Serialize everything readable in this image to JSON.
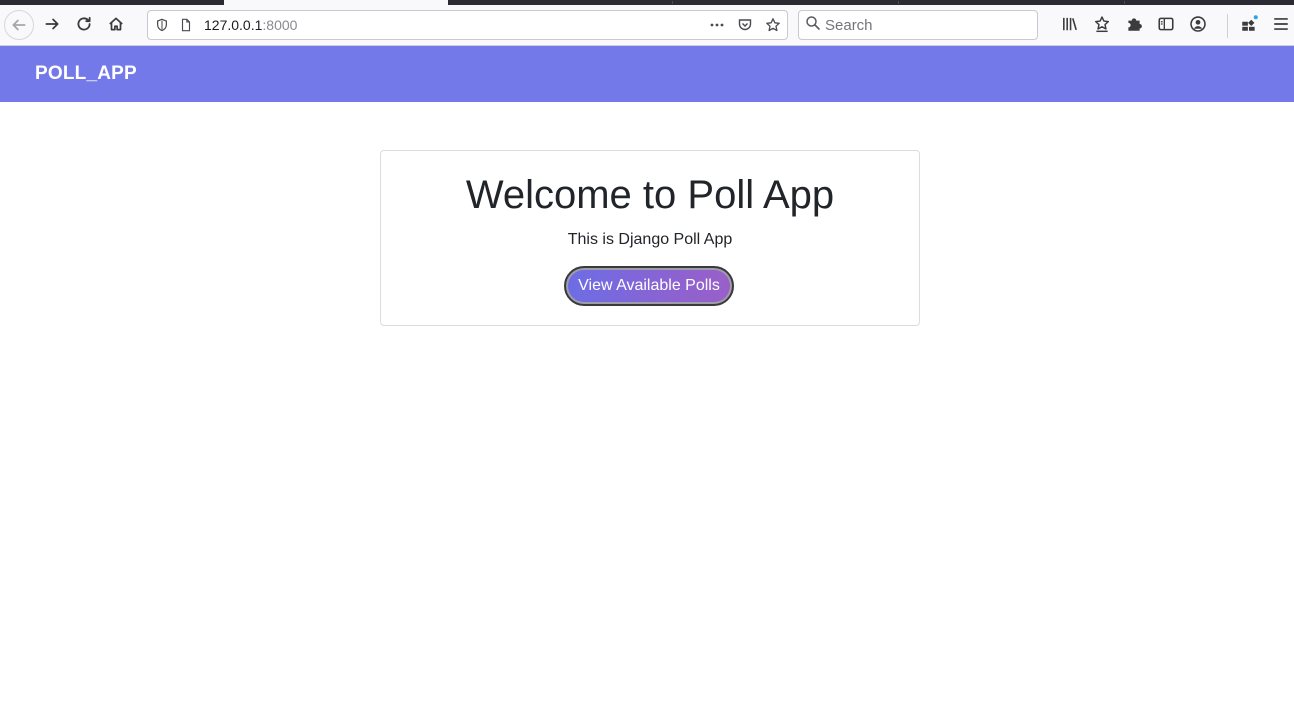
{
  "browser": {
    "url_host": "127.0.0.1",
    "url_port": ":8000",
    "search_placeholder": "Search"
  },
  "navbar": {
    "brand": "POLL_APP",
    "color": "#7379e8"
  },
  "main": {
    "title": "Welcome to Poll App",
    "subtitle": "This is Django Poll App",
    "button_label": "View Available Polls"
  },
  "colors": {
    "accent_start": "#6c6de6",
    "accent_end": "#9a5fc8"
  }
}
